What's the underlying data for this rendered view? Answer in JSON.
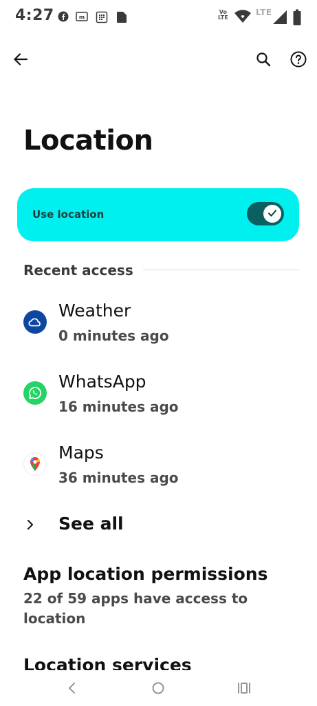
{
  "status_bar": {
    "time": "4:27",
    "volte_label": "Vo LTE",
    "network_label": "LTE",
    "icons": [
      "facebook-icon",
      "m-icon",
      "calendar-icon",
      "notification-icon",
      "wifi-icon",
      "signal-icon",
      "battery-icon"
    ]
  },
  "app_bar": {
    "back_icon": "arrow-left-icon",
    "search_icon": "search-icon",
    "help_icon": "help-circle-icon"
  },
  "page": {
    "title": "Location"
  },
  "use_location": {
    "label": "Use location",
    "enabled": true,
    "accent": "#00f0f0",
    "switch_color": "#0b5f5f"
  },
  "recent_access": {
    "header": "Recent access",
    "items": [
      {
        "name": "Weather",
        "time": "0 minutes ago",
        "icon": "weather-cloud-icon",
        "color": "#0d47a1"
      },
      {
        "name": "WhatsApp",
        "time": "16 minutes ago",
        "icon": "whatsapp-icon",
        "color": "#25d366"
      },
      {
        "name": "Maps",
        "time": "36 minutes ago",
        "icon": "maps-pin-icon",
        "color": "#ea4335"
      }
    ],
    "see_all": "See all"
  },
  "app_permissions": {
    "title": "App location permissions",
    "subtitle": "22 of 59 apps have access to location"
  },
  "location_services": {
    "title": "Location services"
  },
  "nav_bar": {
    "icons": [
      "back-nav-icon",
      "home-nav-icon",
      "recents-nav-icon"
    ]
  }
}
